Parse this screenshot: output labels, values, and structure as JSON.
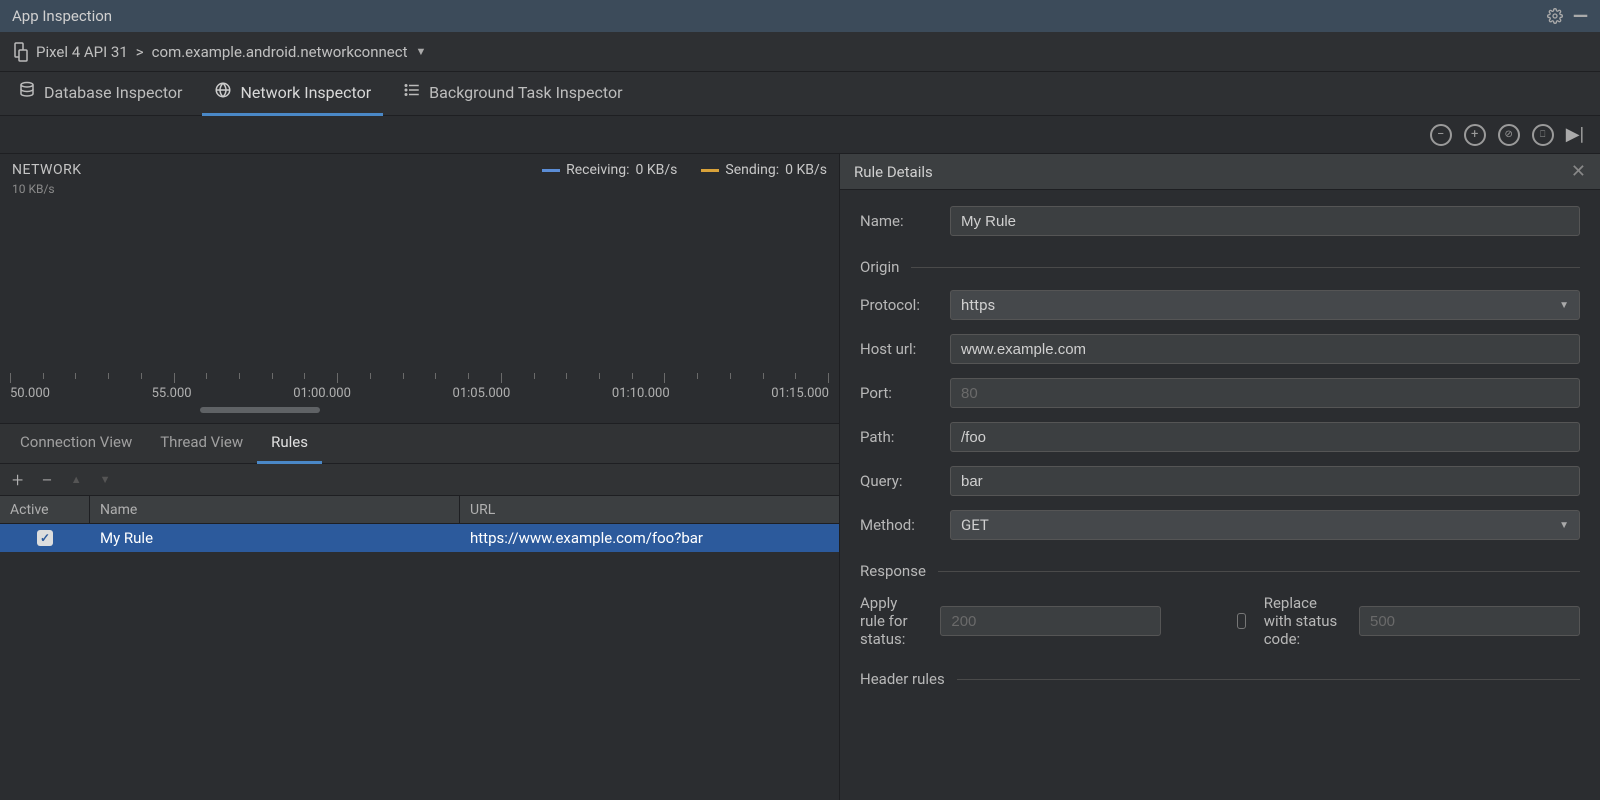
{
  "titlebar": {
    "title": "App Inspection"
  },
  "breadcrumb": {
    "device": "Pixel 4 API 31",
    "separator": ">",
    "package": "com.example.android.networkconnect"
  },
  "inspector_tabs": {
    "db": "Database Inspector",
    "network": "Network Inspector",
    "bg": "Background Task Inspector"
  },
  "network_graph": {
    "title": "NETWORK",
    "axis_label": "10 KB/s",
    "legend_receiving": "Receiving:",
    "legend_receiving_val": "0 KB/s",
    "legend_sending": "Sending:",
    "legend_sending_val": "0 KB/s",
    "ticks": [
      "50.000",
      "55.000",
      "01:00.000",
      "01:05.000",
      "01:10.000",
      "01:15.000"
    ]
  },
  "sub_tabs": {
    "connection": "Connection View",
    "thread": "Thread View",
    "rules": "Rules"
  },
  "rules_table": {
    "headers": {
      "active": "Active",
      "name": "Name",
      "url": "URL"
    },
    "row": {
      "name": "My Rule",
      "url": "https://www.example.com/foo?bar"
    }
  },
  "details": {
    "title": "Rule Details",
    "name_label": "Name:",
    "name_value": "My Rule",
    "origin_header": "Origin",
    "protocol_label": "Protocol:",
    "protocol_value": "https",
    "host_label": "Host url:",
    "host_value": "www.example.com",
    "port_label": "Port:",
    "port_placeholder": "80",
    "path_label": "Path:",
    "path_value": "/foo",
    "query_label": "Query:",
    "query_value": "bar",
    "method_label": "Method:",
    "method_value": "GET",
    "response_header": "Response",
    "apply_status_label": "Apply rule for status:",
    "apply_status_placeholder": "200",
    "replace_label": "Replace with status code:",
    "replace_placeholder": "500",
    "header_rules_header": "Header rules"
  }
}
